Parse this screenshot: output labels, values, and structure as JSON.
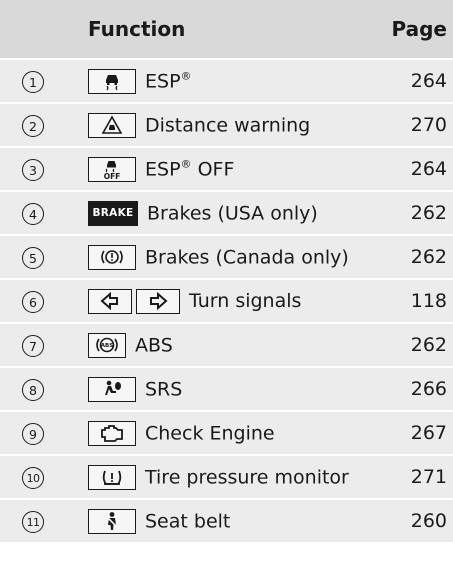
{
  "header": {
    "function": "Function",
    "page": "Page"
  },
  "rows": [
    {
      "num": "1",
      "icon": "esp-skid-icon",
      "label": "ESP",
      "reg": "®",
      "page": "264"
    },
    {
      "num": "2",
      "icon": "distance-warning-icon",
      "label": "Distance warning",
      "page": "270"
    },
    {
      "num": "3",
      "icon": "esp-off-icon",
      "label": "ESP",
      "reg": "®",
      "suffix": " OFF",
      "page": "264"
    },
    {
      "num": "4",
      "icon": "brake-icon",
      "icon_text": "BRAKE",
      "label": "Brakes (USA only)",
      "page": "262"
    },
    {
      "num": "5",
      "icon": "brake-circle-icon",
      "label": "Brakes (Canada only)",
      "page": "262"
    },
    {
      "num": "6",
      "icon": "turn-signal-icons",
      "label": "Turn signals",
      "page": "118"
    },
    {
      "num": "7",
      "icon": "abs-icon",
      "label": "ABS",
      "page": "262"
    },
    {
      "num": "8",
      "icon": "srs-airbag-icon",
      "label": "SRS",
      "page": "266"
    },
    {
      "num": "9",
      "icon": "check-engine-icon",
      "label": "Check Engine",
      "page": "267"
    },
    {
      "num": "10",
      "icon": "tire-pressure-icon",
      "label": "Tire pressure monitor",
      "page": "271"
    },
    {
      "num": "11",
      "icon": "seat-belt-icon",
      "label": "Seat belt",
      "page": "260"
    }
  ]
}
